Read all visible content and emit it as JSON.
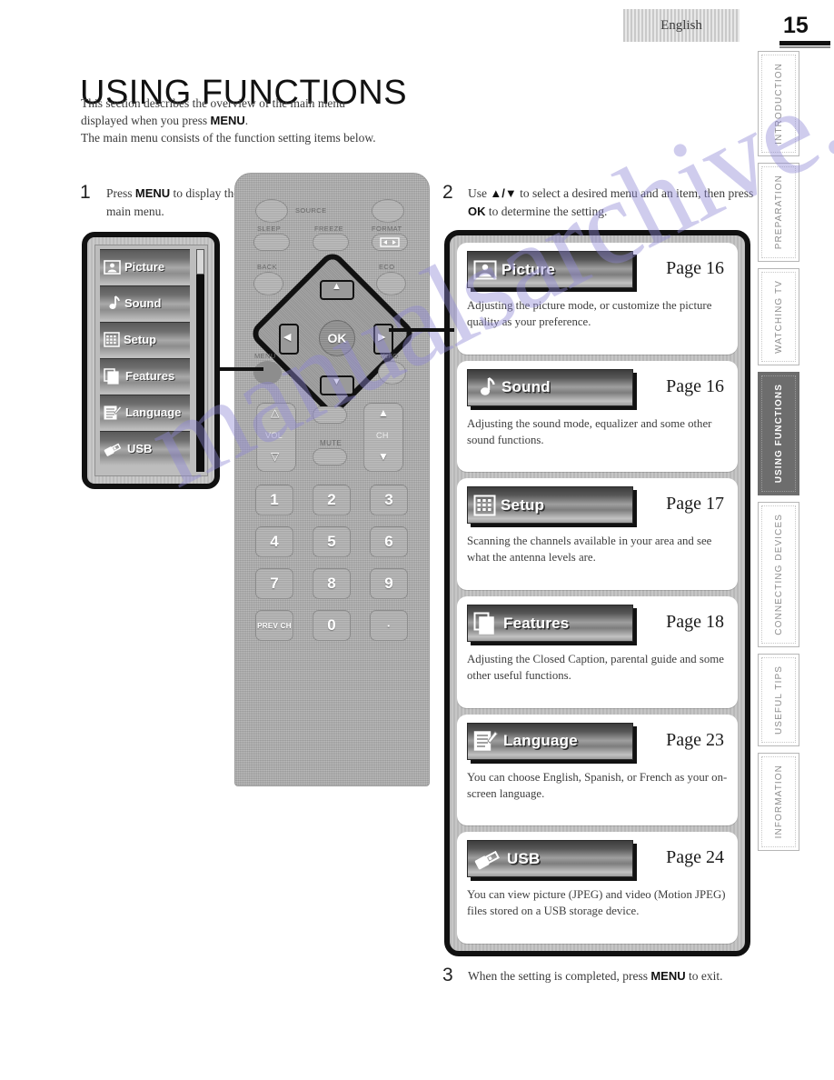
{
  "header": {
    "language_tab": "English",
    "page_number": "15"
  },
  "side_tabs": [
    {
      "label": "INTRODUCTION",
      "active": false
    },
    {
      "label": "PREPARATION",
      "active": false
    },
    {
      "label": "WATCHING TV",
      "active": false
    },
    {
      "label": "USING FUNCTIONS",
      "active": true
    },
    {
      "label": "CONNECTING DEVICES",
      "active": false
    },
    {
      "label": "USEFUL TIPS",
      "active": false
    },
    {
      "label": "INFORMATION",
      "active": false
    }
  ],
  "title": "USING FUNCTIONS",
  "intro": {
    "line1": "This section describes the overview of the main menu",
    "line2a": "displayed when you press ",
    "line2b": "MENU",
    "line2c": ".",
    "line3": "The main menu consists of the function setting items below."
  },
  "steps": {
    "one": {
      "number": "1",
      "text_a": "Press ",
      "text_b": "MENU",
      "text_c": " to display the main menu."
    },
    "two": {
      "number": "2",
      "text_a": "Use ",
      "arrows": "▲/▼",
      "text_b": " to select a desired menu and an item, then press ",
      "text_c": "OK",
      "text_d": " to determine the setting."
    },
    "three": {
      "number": "3",
      "text_a": "When the setting is completed, press ",
      "text_b": "MENU",
      "text_c": " to exit."
    }
  },
  "osd_menu": {
    "items": [
      {
        "label": "Picture",
        "icon": "picture-icon"
      },
      {
        "label": "Sound",
        "icon": "sound-icon"
      },
      {
        "label": "Setup",
        "icon": "setup-icon"
      },
      {
        "label": "Features",
        "icon": "features-icon"
      },
      {
        "label": "Language",
        "icon": "language-icon"
      },
      {
        "label": "USB",
        "icon": "usb-icon"
      }
    ]
  },
  "menu_cards": [
    {
      "label": "Picture",
      "icon": "picture-icon",
      "page": "Page 16",
      "desc": "Adjusting the picture mode, or customize the picture quality as your preference."
    },
    {
      "label": "Sound",
      "icon": "sound-icon",
      "page": "Page 16",
      "desc": "Adjusting the sound mode, equalizer and some other sound functions."
    },
    {
      "label": "Setup",
      "icon": "setup-icon",
      "page": "Page 17",
      "desc": "Scanning the channels available in your area and see what the antenna levels are."
    },
    {
      "label": "Features",
      "icon": "features-icon",
      "page": "Page 18",
      "desc": "Adjusting the Closed Caption, parental guide and some other useful functions."
    },
    {
      "label": "Language",
      "icon": "language-icon",
      "page": "Page 23",
      "desc": "You can choose English, Spanish, or French as your on-screen language."
    },
    {
      "label": "USB",
      "icon": "usb-icon",
      "page": "Page 24",
      "desc": "You can view picture (JPEG) and video (Motion JPEG) files stored on a USB storage device."
    }
  ],
  "remote": {
    "labels": {
      "source": "SOURCE",
      "sleep": "SLEEP",
      "freeze": "FREEZE",
      "format": "FORMAT",
      "back": "BACK",
      "eco": "ECO",
      "menu": "MENU",
      "info": "INFO",
      "ok": "OK",
      "vol": "VOL",
      "mute": "MUTE",
      "ch": "CH"
    },
    "keypad": [
      "1",
      "2",
      "3",
      "4",
      "5",
      "6",
      "7",
      "8",
      "9",
      "PREV CH",
      "0",
      "·"
    ]
  },
  "watermark": "manualsarchive.com",
  "colors": {
    "accent_dark": "#111111",
    "panel_gray": "#c2c2c2",
    "active_tab": "#6d6d6d",
    "watermark": "#8f88d6"
  }
}
